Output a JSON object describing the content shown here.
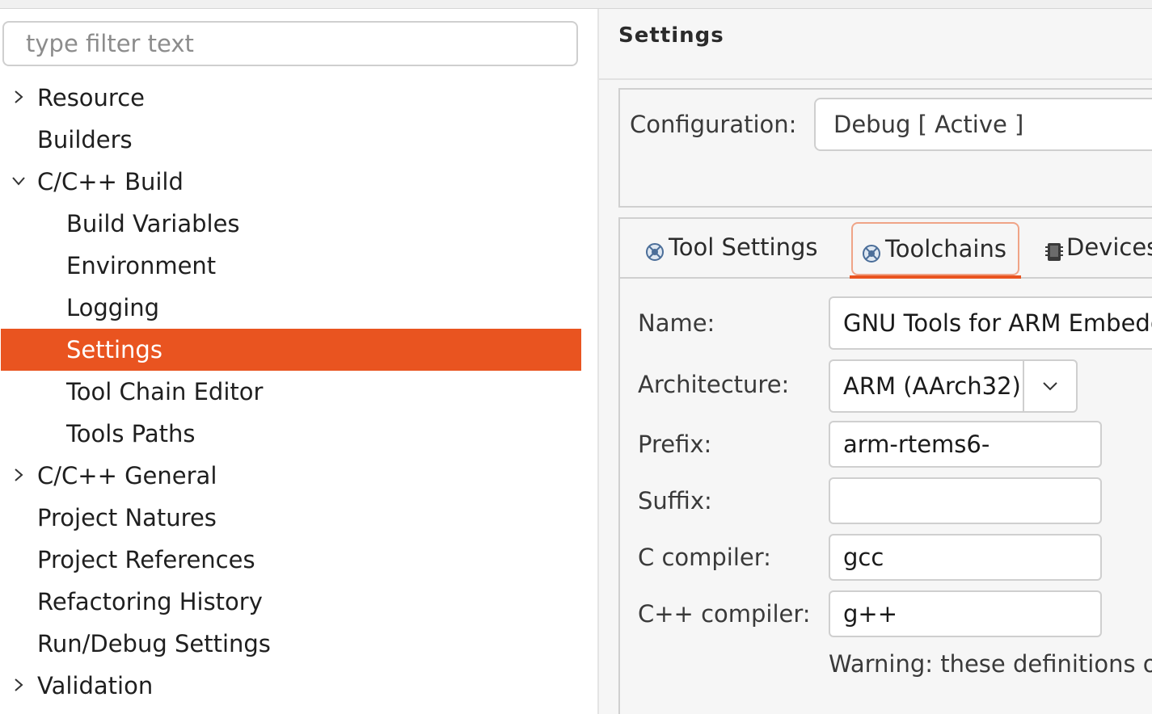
{
  "filter": {
    "placeholder": "type filter text"
  },
  "tree": {
    "items": [
      {
        "label": "Resource",
        "expander": "collapsed"
      },
      {
        "label": "Builders"
      },
      {
        "label": "C/C++ Build",
        "expander": "expanded"
      },
      {
        "label": "Build Variables"
      },
      {
        "label": "Environment"
      },
      {
        "label": "Logging"
      },
      {
        "label": "Settings",
        "selected": true
      },
      {
        "label": "Tool Chain Editor"
      },
      {
        "label": "Tools Paths"
      },
      {
        "label": "C/C++ General",
        "expander": "collapsed"
      },
      {
        "label": "Project Natures"
      },
      {
        "label": "Project References"
      },
      {
        "label": "Refactoring History"
      },
      {
        "label": "Run/Debug Settings"
      },
      {
        "label": "Validation",
        "expander": "collapsed"
      }
    ]
  },
  "panel": {
    "title": "Settings",
    "configuration": {
      "label": "Configuration:",
      "value": "Debug  [ Active ]"
    },
    "tabs": [
      {
        "label": "Tool Settings",
        "icon": "tool-settings-icon"
      },
      {
        "label": "Toolchains",
        "icon": "toolchains-icon",
        "active": true
      },
      {
        "label": "Devices",
        "icon": "devices-icon"
      }
    ],
    "fields": {
      "name": {
        "label": "Name:",
        "value": "GNU Tools for ARM Embedded Processors"
      },
      "architecture": {
        "label": "Architecture:",
        "value": "ARM (AArch32)"
      },
      "prefix": {
        "label": "Prefix:",
        "value": "arm-rtems6-"
      },
      "suffix": {
        "label": "Suffix:",
        "value": ""
      },
      "c_compiler": {
        "label": "C compiler:",
        "value": "gcc"
      },
      "cpp_compiler": {
        "label": "C++ compiler:",
        "value": "g++"
      }
    },
    "warning": "Warning: these definitions override the toolchain settings."
  },
  "colors": {
    "selection": "#e95420",
    "tab_focus_border": "#f0a487"
  }
}
